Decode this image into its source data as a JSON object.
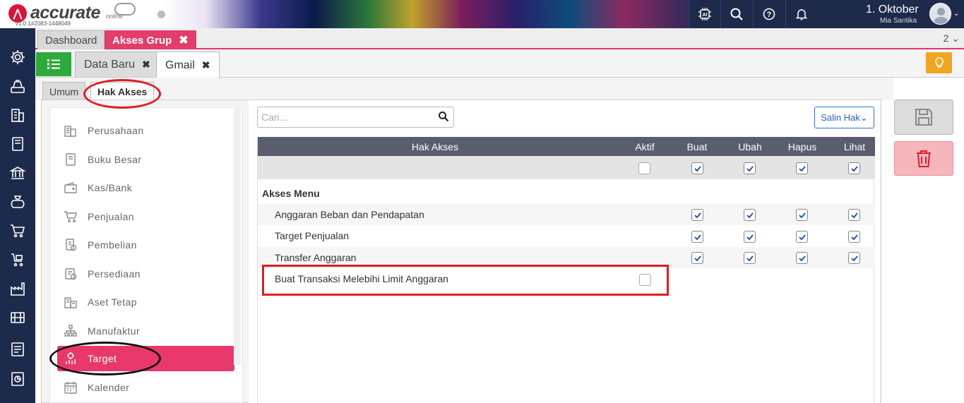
{
  "app": {
    "logo_text": "accurate",
    "logo_sub": "online",
    "version": "v1.0.1#2083-1448049",
    "date": "1. Oktober",
    "user": "Mia Santika",
    "top_icons": [
      "ai-icon",
      "search-icon",
      "help-icon",
      "bell-icon"
    ]
  },
  "tabs_level1": [
    {
      "label": "Dashboard",
      "active": false
    },
    {
      "label": "Akses Grup",
      "active": true,
      "close": "✖"
    }
  ],
  "tabs_level1_count": "2 ⌄",
  "tabs_level2": [
    {
      "label": "Data Baru",
      "active": false,
      "close": "✖"
    },
    {
      "label": "Gmail",
      "active": true,
      "close": "✖"
    }
  ],
  "subtabs": [
    {
      "label": "Umum",
      "active": false
    },
    {
      "label": "Hak Akses",
      "active": true
    }
  ],
  "sidebar_icons": [
    "settings-icon",
    "cashier-icon",
    "building-icon",
    "book-icon",
    "bank-icon",
    "money-bag-icon",
    "cart-icon",
    "purchase-icon",
    "factory-icon",
    "inventory-icon",
    "tax-icon",
    "report-icon"
  ],
  "modules": [
    {
      "label": "Perusahaan",
      "icon": "company-icon",
      "active": false
    },
    {
      "label": "Buku Besar",
      "icon": "ledger-icon",
      "active": false
    },
    {
      "label": "Kas/Bank",
      "icon": "wallet-icon",
      "active": false
    },
    {
      "label": "Penjualan",
      "icon": "cart-icon",
      "active": false
    },
    {
      "label": "Pembelian",
      "icon": "purchase-icon",
      "active": false
    },
    {
      "label": "Persediaan",
      "icon": "inventory-icon",
      "active": false
    },
    {
      "label": "Aset Tetap",
      "icon": "asset-icon",
      "active": false
    },
    {
      "label": "Manufaktur",
      "icon": "manufacture-icon",
      "active": false
    },
    {
      "label": "Target",
      "icon": "target-icon",
      "active": true
    },
    {
      "label": "Kalender",
      "icon": "calendar-icon",
      "active": false
    }
  ],
  "search": {
    "placeholder": "Cari..."
  },
  "copy_button": "Salin Hak⌄",
  "table": {
    "columns": [
      "Hak Akses",
      "Aktif",
      "Buat",
      "Ubah",
      "Hapus",
      "Lihat"
    ],
    "header_checks": {
      "Aktif": false,
      "Buat": true,
      "Ubah": true,
      "Hapus": true,
      "Lihat": true
    },
    "section": "Akses Menu",
    "rows": [
      {
        "label": "Anggaran Beban dan Pendapatan",
        "aktif": null,
        "buat": true,
        "ubah": true,
        "hapus": true,
        "lihat": true
      },
      {
        "label": "Target Penjualan",
        "aktif": null,
        "buat": true,
        "ubah": true,
        "hapus": true,
        "lihat": true
      },
      {
        "label": "Transfer Anggaran",
        "aktif": null,
        "buat": true,
        "ubah": true,
        "hapus": true,
        "lihat": true
      },
      {
        "label": "Buat Transaksi Melebihi Limit Anggaran",
        "aktif": false,
        "buat": null,
        "ubah": null,
        "hapus": null,
        "lihat": null
      }
    ]
  },
  "actions": [
    "save-icon",
    "trash-icon"
  ],
  "colors": {
    "accent": "#e8386b",
    "sidebar": "#1c2b4b",
    "green": "#2fa83c",
    "orange": "#f0a623",
    "header": "#5a5d6e"
  }
}
